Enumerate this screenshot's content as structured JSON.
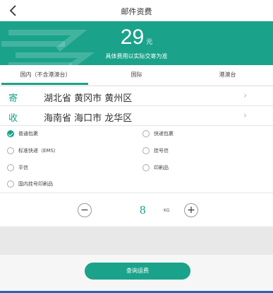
{
  "nav": {
    "back_icon": "chevron-left-icon",
    "title": "邮件资费"
  },
  "banner": {
    "price": "29",
    "unit": "元",
    "note": "具体费用以实际交寄为准",
    "color": "#1aa38a"
  },
  "tabs": [
    {
      "label": "国内（不含港澳台）",
      "active": true
    },
    {
      "label": "国际",
      "active": false
    },
    {
      "label": "港澳台",
      "active": false
    }
  ],
  "sender": {
    "tag": "寄",
    "address": "湖北省 黄冈市 黄州区",
    "chevron": "›"
  },
  "receiver": {
    "tag": "收",
    "address": "海南省 海口市 龙华区",
    "chevron": "›"
  },
  "options": [
    {
      "label": "普通包裹",
      "checked": true
    },
    {
      "label": "快递包裹",
      "checked": false
    },
    {
      "label": "标准快递（EMS）",
      "checked": false
    },
    {
      "label": "挂号信",
      "checked": false
    },
    {
      "label": "平信",
      "checked": false
    },
    {
      "label": "印刷品",
      "checked": false
    },
    {
      "label": "国内挂号印刷品",
      "checked": false
    }
  ],
  "weight": {
    "minus": "−",
    "value": "8",
    "unit": "KG",
    "plus": "+"
  },
  "query_button": "查询运费"
}
